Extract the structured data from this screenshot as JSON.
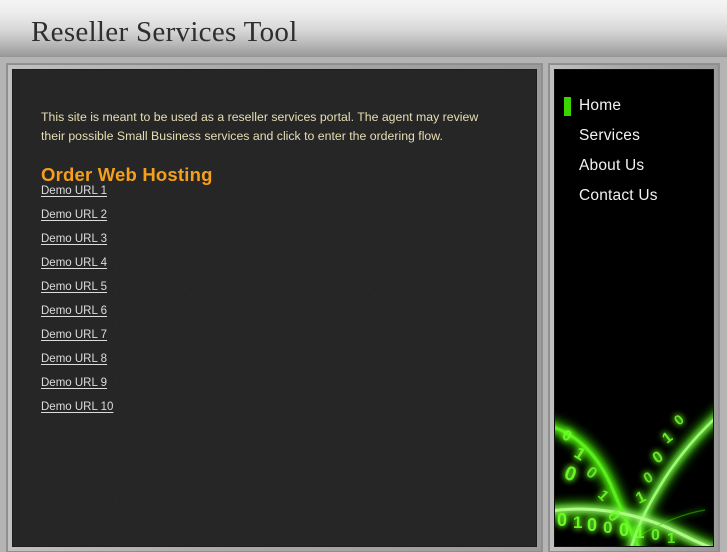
{
  "header": {
    "title": "Reseller Services Tool",
    "background_top_color": "#f4f4f4",
    "background_bottom_color": "#949494"
  },
  "main": {
    "intro_text": "This site is meant to be used as a reseller services portal.  The agent may review their possible Small Business services and click to enter the ordering flow.",
    "intro_text_color": "#e6dfb4",
    "heading": "Order Web Hosting",
    "heading_color": "#f59f1c",
    "panel_background_color": "#262626",
    "links": [
      {
        "label": "Demo URL 1"
      },
      {
        "label": "Demo URL 2"
      },
      {
        "label": "Demo URL 3"
      },
      {
        "label": "Demo URL 4"
      },
      {
        "label": "Demo URL 5"
      },
      {
        "label": "Demo URL 6"
      },
      {
        "label": "Demo URL 7"
      },
      {
        "label": "Demo URL 8"
      },
      {
        "label": "Demo URL 9"
      },
      {
        "label": "Demo URL 10"
      }
    ],
    "link_color": "#dcdcdc"
  },
  "sidebar": {
    "panel_background_color": "#000000",
    "active_marker_color": "#3ad400",
    "items": [
      {
        "label": "Home",
        "active": true
      },
      {
        "label": "Services",
        "active": false
      },
      {
        "label": "About Us",
        "active": false
      },
      {
        "label": "Contact Us",
        "active": false
      }
    ],
    "decoration": {
      "name": "green-binary-code-graphic",
      "glow_color": "#3ad400",
      "digits": "0100010101101001"
    }
  }
}
